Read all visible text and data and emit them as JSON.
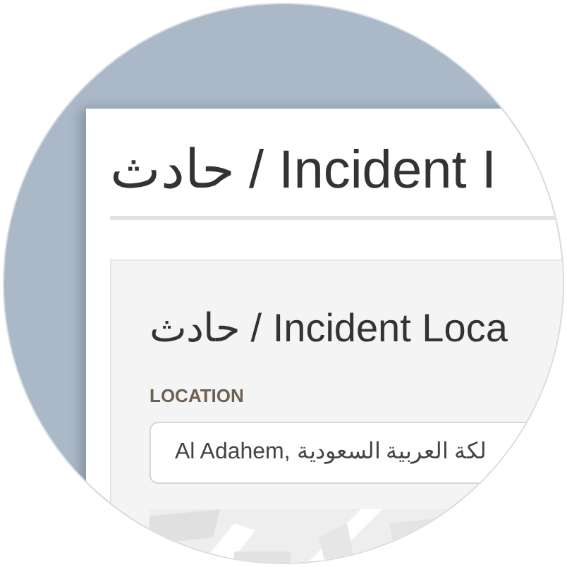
{
  "page": {
    "title": "حادث / Incident I"
  },
  "card": {
    "title": "حادث / Incident Loca",
    "location": {
      "label": "LOCATION",
      "value": "Al Adahem, لكة العربية السعودية"
    }
  }
}
